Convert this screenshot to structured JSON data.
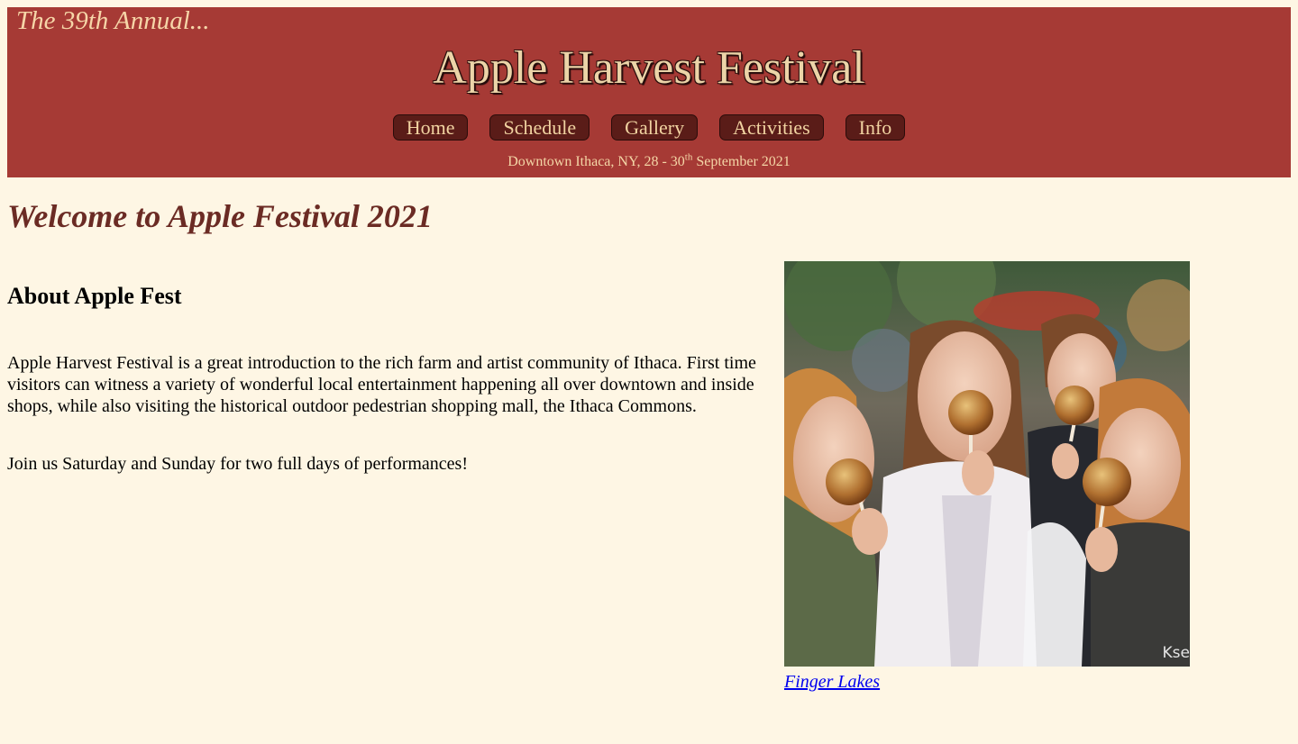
{
  "header": {
    "tagline": "The 39th Annual...",
    "title": "Apple Harvest Festival",
    "dates_prefix": "Downtown Ithaca, NY, 28 - 30",
    "dates_sup": "th",
    "dates_suffix": " September 2021"
  },
  "nav": [
    {
      "label": "Home"
    },
    {
      "label": "Schedule"
    },
    {
      "label": "Gallery"
    },
    {
      "label": "Activities"
    },
    {
      "label": "Info"
    }
  ],
  "main": {
    "heading": "Welcome to Apple Festival 2021",
    "about_heading": "About Apple Fest",
    "paragraph1": "Apple Harvest Festival is a great introduction to the rich farm and artist community of Ithaca. First time visitors can witness a variety of wonderful local entertainment happening all over downtown and inside shops, while also visiting the historical outdoor pedestrian shopping mall, the Ithaca Commons.",
    "paragraph2": "Join us Saturday and Sunday for two full days of performances!"
  },
  "photo": {
    "caption_link": "Finger Lakes",
    "watermark": "Kse"
  },
  "colors": {
    "banner": "#a63a35",
    "background": "#fef6e4",
    "nav_button": "#5a1c18",
    "heading": "#6b2b24"
  }
}
